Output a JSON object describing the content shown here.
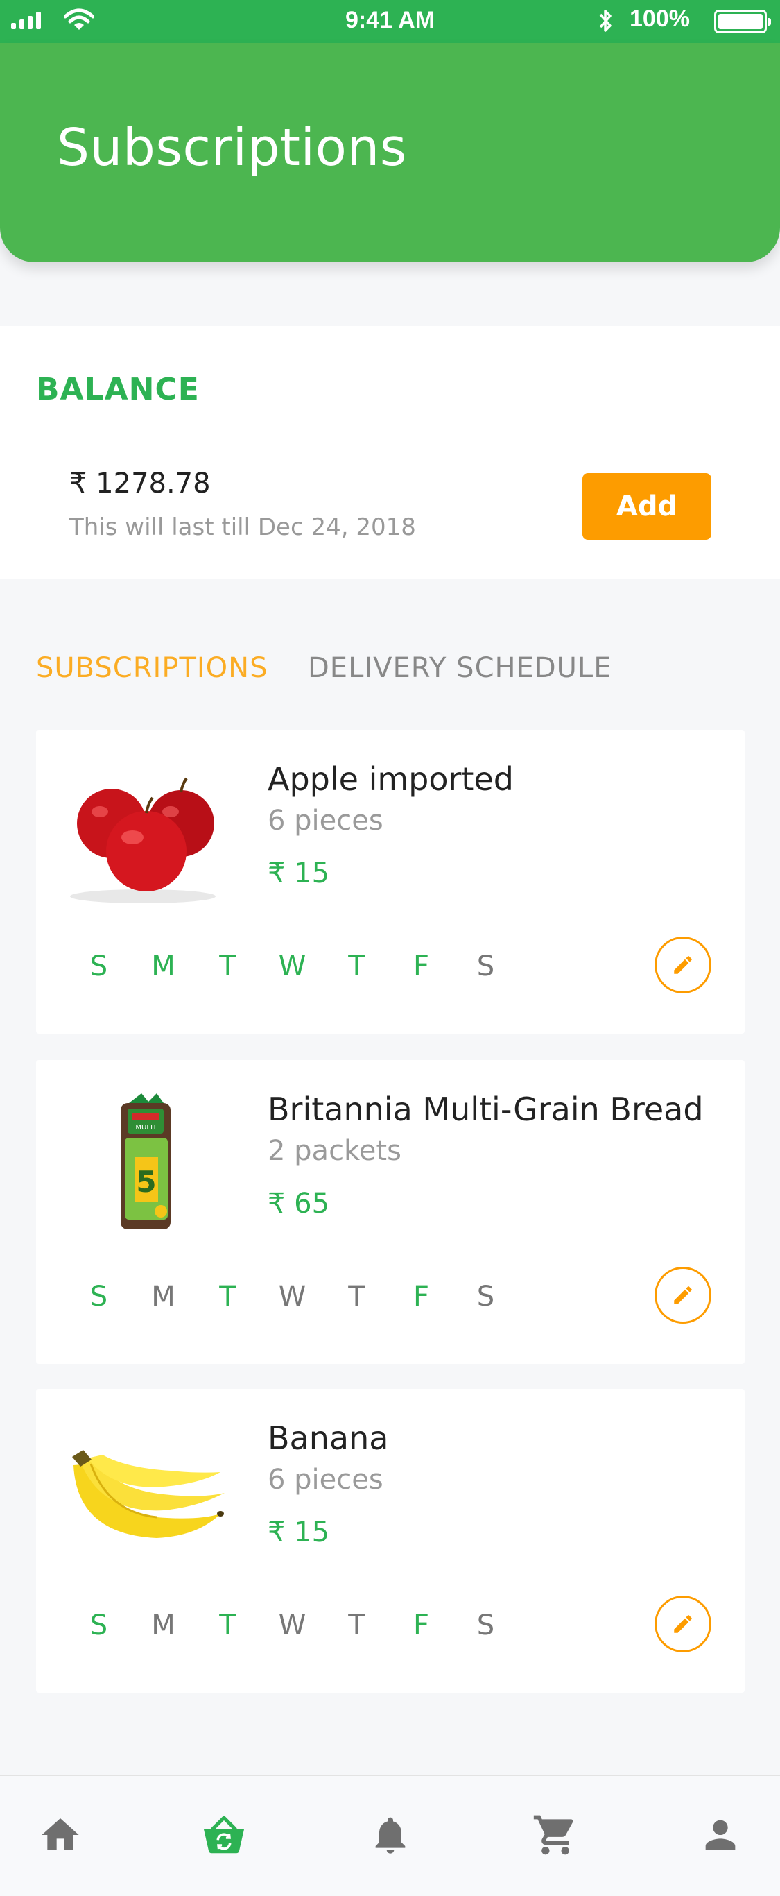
{
  "status_bar": {
    "time": "9:41 AM",
    "battery": "100%",
    "icons": [
      "signal-icon",
      "wifi-icon",
      "bluetooth-icon",
      "battery-icon"
    ]
  },
  "header": {
    "title": "Subscriptions"
  },
  "balance": {
    "label": "BALANCE",
    "amount": "₹ 1278.78",
    "valid_till": "This will last till Dec 24, 2018",
    "add_label": "Add"
  },
  "tabs": [
    {
      "label": "SUBSCRIPTIONS",
      "active": true
    },
    {
      "label": "DELIVERY SCHEDULE",
      "active": false
    }
  ],
  "subscriptions": [
    {
      "name": "Apple imported",
      "quantity": "6 pieces",
      "price": "₹ 15",
      "image": "apple-image",
      "days": [
        {
          "label": "S",
          "on": true
        },
        {
          "label": "M",
          "on": true
        },
        {
          "label": "T",
          "on": true
        },
        {
          "label": "W",
          "on": true
        },
        {
          "label": "T",
          "on": true
        },
        {
          "label": "F",
          "on": true
        },
        {
          "label": "S",
          "on": false
        }
      ]
    },
    {
      "name": "Britannia Multi-Grain Bread",
      "quantity": "2 packets",
      "price": "₹ 65",
      "image": "bread-image",
      "days": [
        {
          "label": "S",
          "on": true
        },
        {
          "label": "M",
          "on": false
        },
        {
          "label": "T",
          "on": true
        },
        {
          "label": "W",
          "on": false
        },
        {
          "label": "T",
          "on": false
        },
        {
          "label": "F",
          "on": true
        },
        {
          "label": "S",
          "on": false
        }
      ]
    },
    {
      "name": "Banana",
      "quantity": "6 pieces",
      "price": "₹ 15",
      "image": "banana-image",
      "days": [
        {
          "label": "S",
          "on": true
        },
        {
          "label": "M",
          "on": false
        },
        {
          "label": "T",
          "on": true
        },
        {
          "label": "W",
          "on": false
        },
        {
          "label": "T",
          "on": false
        },
        {
          "label": "F",
          "on": true
        },
        {
          "label": "S",
          "on": false
        }
      ]
    }
  ],
  "bottom_nav": [
    {
      "icon": "home-icon",
      "active": false
    },
    {
      "icon": "subscription-basket-icon",
      "active": true
    },
    {
      "icon": "bell-icon",
      "active": false
    },
    {
      "icon": "cart-icon",
      "active": false
    },
    {
      "icon": "profile-icon",
      "active": false
    }
  ],
  "colors": {
    "primary_green": "#4cb650",
    "accent_orange": "#fd9c00",
    "tab_active": "#fbac24",
    "text_muted": "#999999",
    "nav_inactive": "#6f6f6f"
  }
}
